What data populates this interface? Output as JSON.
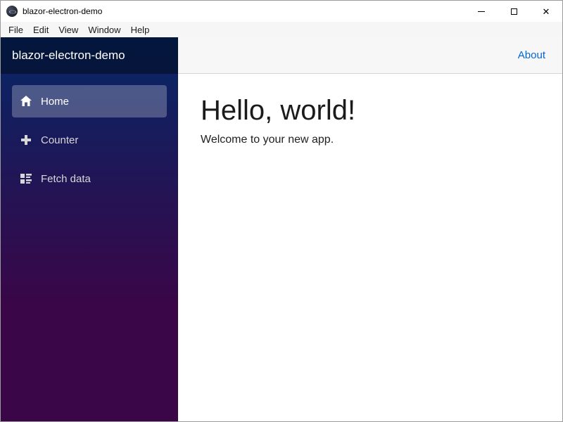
{
  "window": {
    "title": "blazor-electron-demo",
    "close_glyph": "✕"
  },
  "menu": {
    "items": [
      "File",
      "Edit",
      "View",
      "Window",
      "Help"
    ]
  },
  "sidebar": {
    "brand": "blazor-electron-demo",
    "items": [
      {
        "label": "Home",
        "icon": "home-icon",
        "active": true
      },
      {
        "label": "Counter",
        "icon": "plus-icon",
        "active": false
      },
      {
        "label": "Fetch data",
        "icon": "list-rich-icon",
        "active": false
      }
    ],
    "colors": {
      "gradient_top": "#052767",
      "gradient_bottom": "#3a0647",
      "active_item_bg": "rgba(255,255,255,0.25)"
    }
  },
  "topbar": {
    "about_label": "About",
    "link_color": "#0366d6"
  },
  "main": {
    "heading": "Hello, world!",
    "welcome": "Welcome to your new app."
  }
}
